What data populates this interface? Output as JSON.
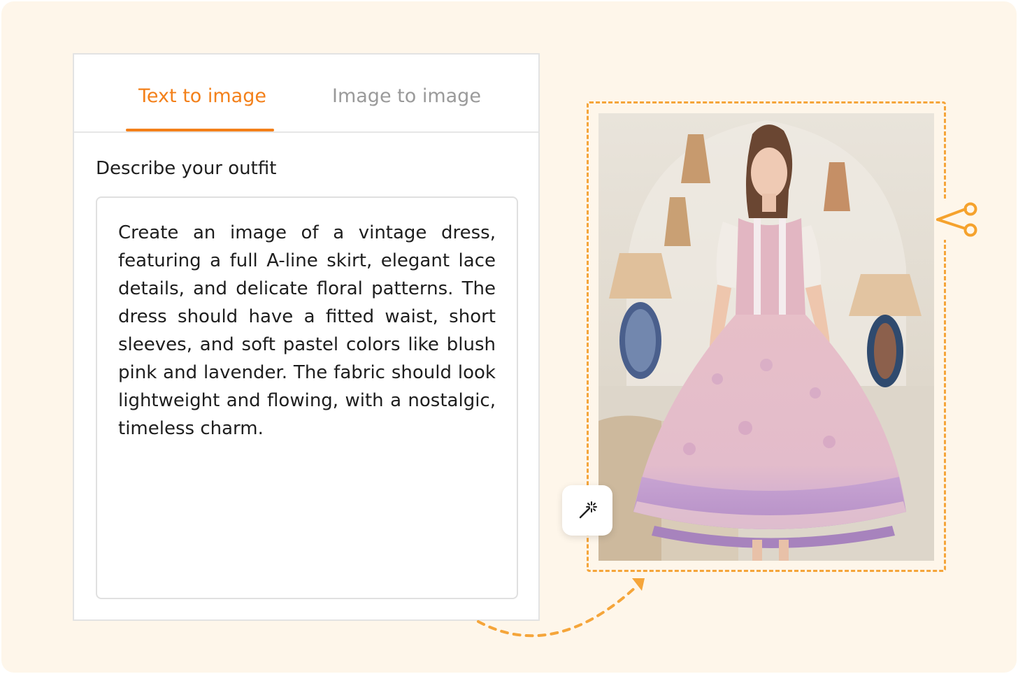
{
  "tabs": {
    "text_to_image": "Text to image",
    "image_to_image": "Image to image"
  },
  "form": {
    "label": "Describe your outfit",
    "prompt": "Create an image of a vintage dress, featuring a full A-line skirt, elegant lace details, and delicate floral patterns. The dress should have a fitted waist, short sleeves, and soft pastel colors like blush pink and lavender. The fabric should look lightweight and flowing, with a nostalgic, timeless charm."
  },
  "icons": {
    "wand": "magic-wand-icon",
    "scissors": "scissors-icon",
    "arrow": "dashed-arrow-icon"
  },
  "colors": {
    "accent": "#f3801a",
    "dashed": "#f5a53a",
    "background": "#fef6ea",
    "inactive_tab": "#9a9a9a"
  }
}
